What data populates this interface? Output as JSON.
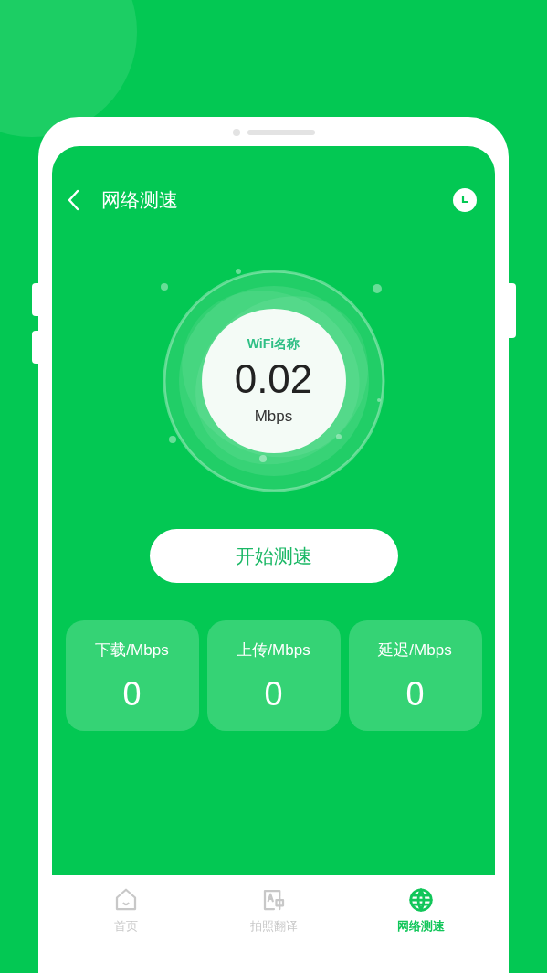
{
  "header": {
    "title": "网络测速"
  },
  "gauge": {
    "label": "WiFi名称",
    "value": "0.02",
    "unit": "Mbps"
  },
  "start_button": {
    "label": "开始测速"
  },
  "stats": [
    {
      "label": "下载/Mbps",
      "value": "0"
    },
    {
      "label": "上传/Mbps",
      "value": "0"
    },
    {
      "label": "延迟/Mbps",
      "value": "0"
    }
  ],
  "tabs": [
    {
      "kind": "home",
      "label": "首页",
      "selected": false
    },
    {
      "kind": "translate",
      "label": "拍照翻译",
      "selected": false
    },
    {
      "kind": "globe",
      "label": "网络测速",
      "selected": true
    }
  ]
}
